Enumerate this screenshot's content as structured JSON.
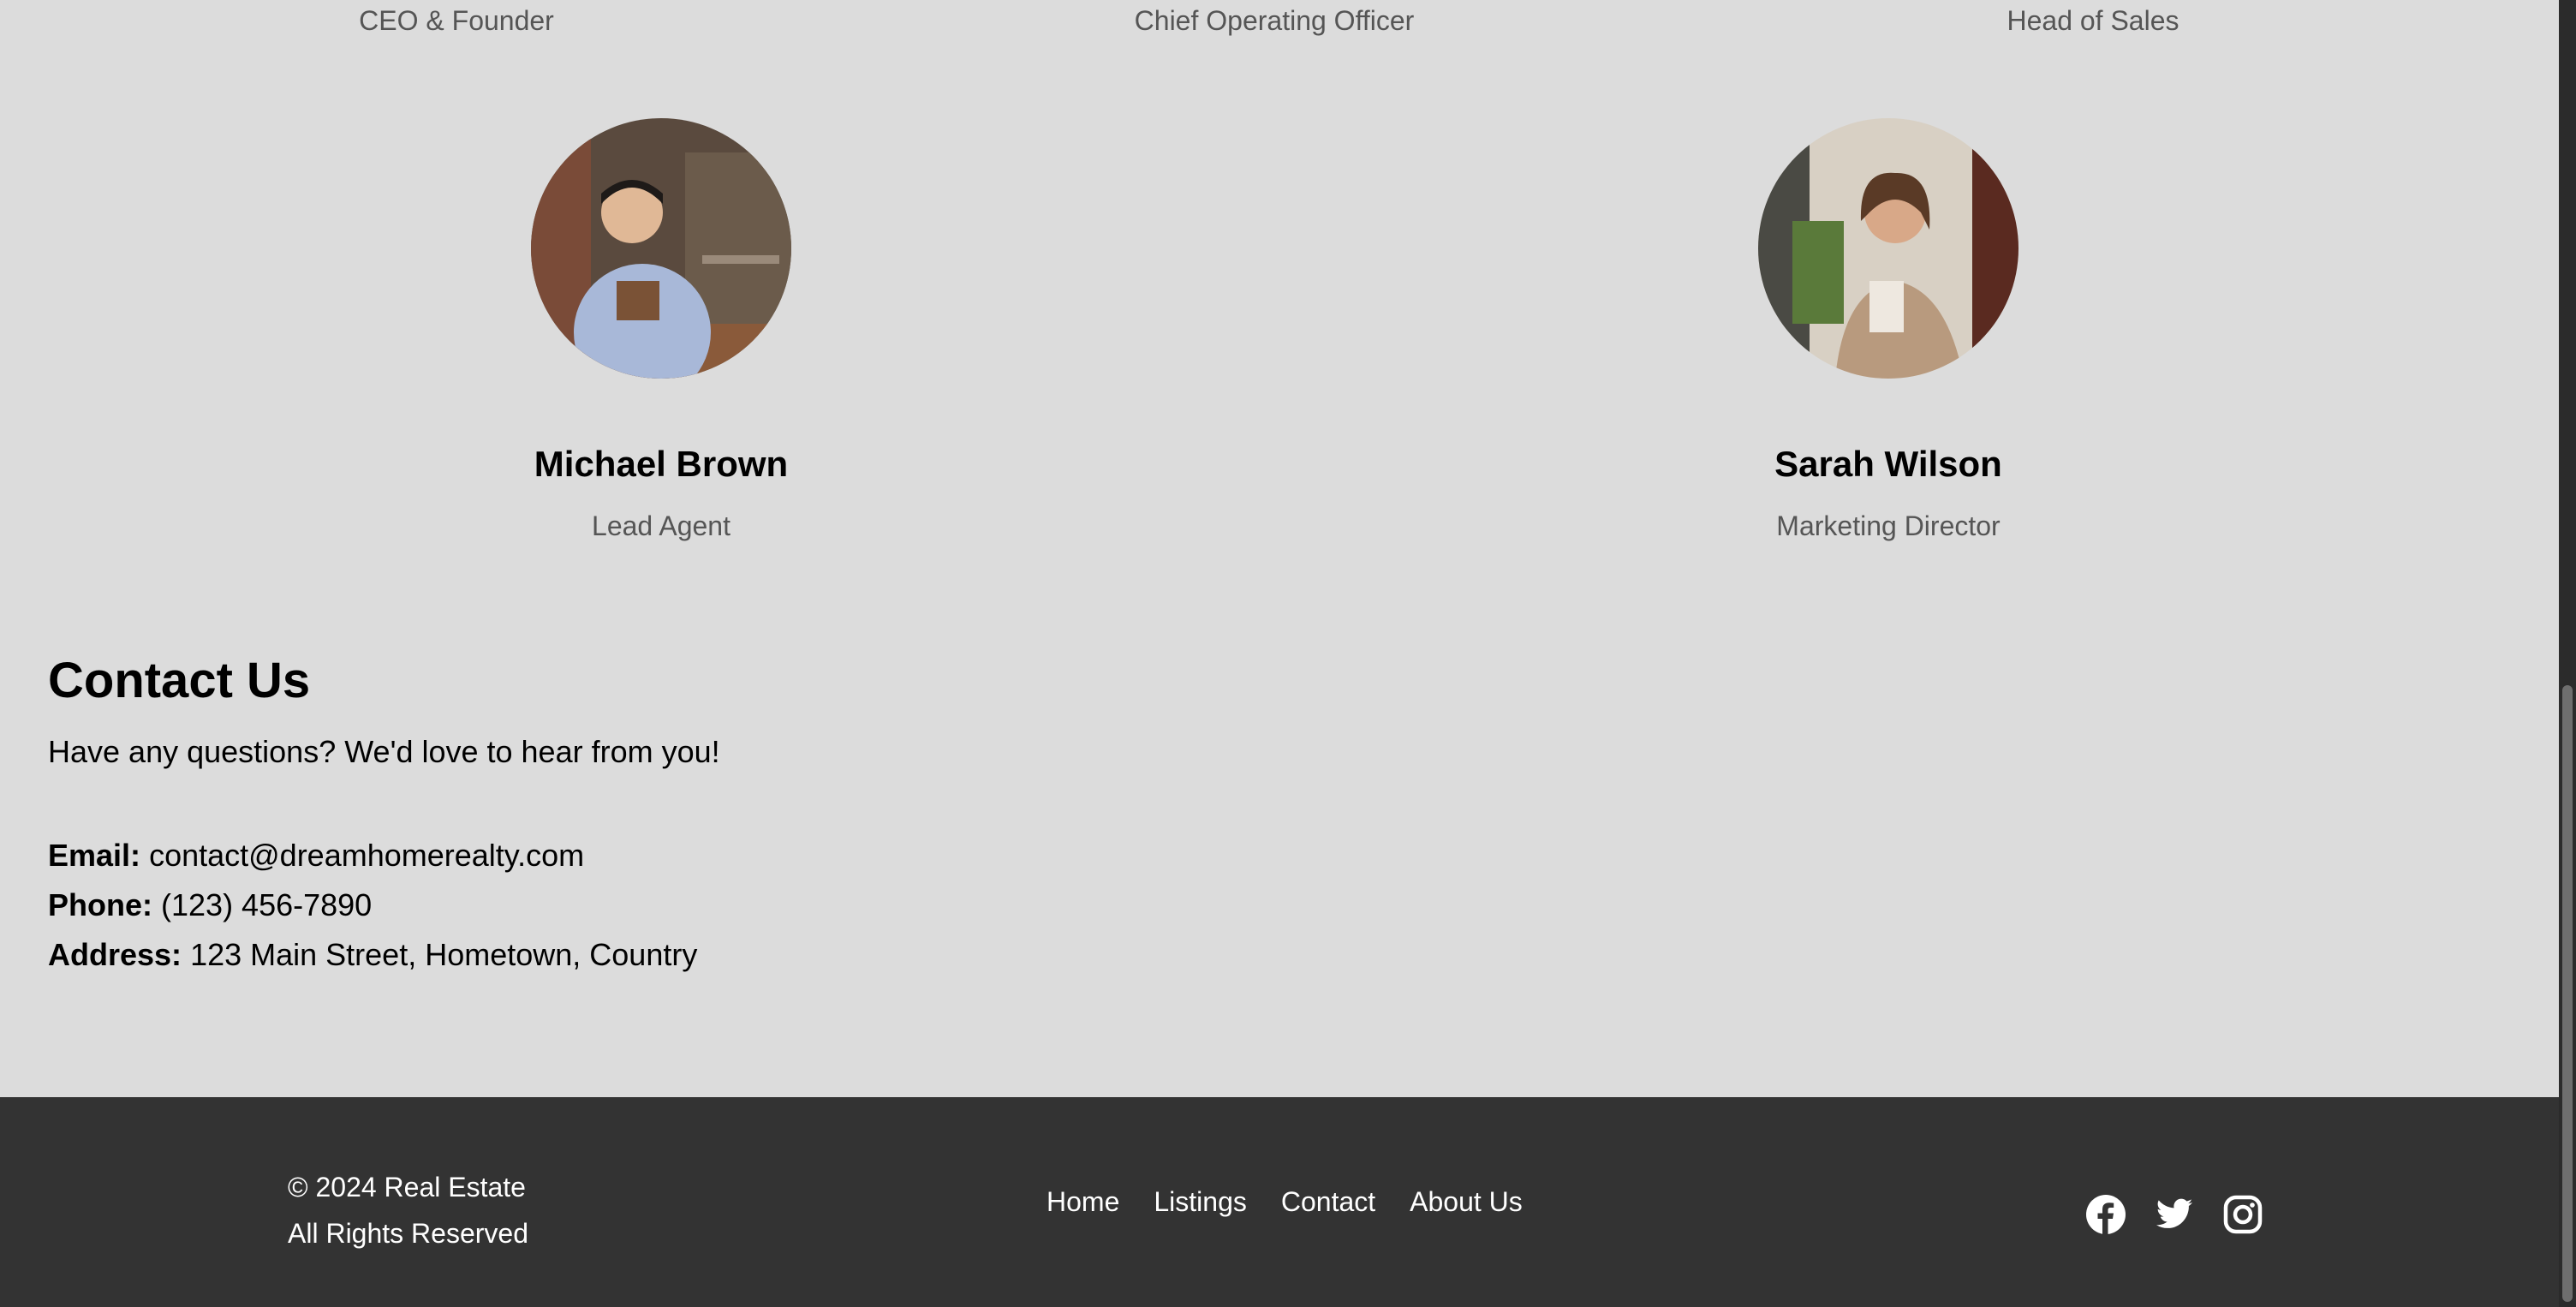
{
  "team": {
    "top_roles": [
      "CEO & Founder",
      "Chief Operating Officer",
      "Head of Sales"
    ],
    "members": [
      {
        "name": "Michael Brown",
        "role": "Lead Agent"
      },
      {
        "name": "Sarah Wilson",
        "role": "Marketing Director"
      }
    ]
  },
  "contact": {
    "title": "Contact Us",
    "intro": "Have any questions? We'd love to hear from you!",
    "email_label": "Email:",
    "email_value": "contact@dreamhomerealty.com",
    "phone_label": "Phone:",
    "phone_value": "(123) 456-7890",
    "address_label": "Address:",
    "address_value": "123 Main Street, Hometown, Country"
  },
  "footer": {
    "copyright": "© 2024 Real Estate",
    "rights": "All Rights Reserved",
    "nav": [
      "Home",
      "Listings",
      "Contact",
      "About Us"
    ],
    "social_icons": [
      "facebook-icon",
      "twitter-icon",
      "instagram-icon"
    ]
  },
  "colors": {
    "page_bg": "#dcdcdc",
    "footer_bg": "#333333",
    "muted_text": "#555555"
  }
}
